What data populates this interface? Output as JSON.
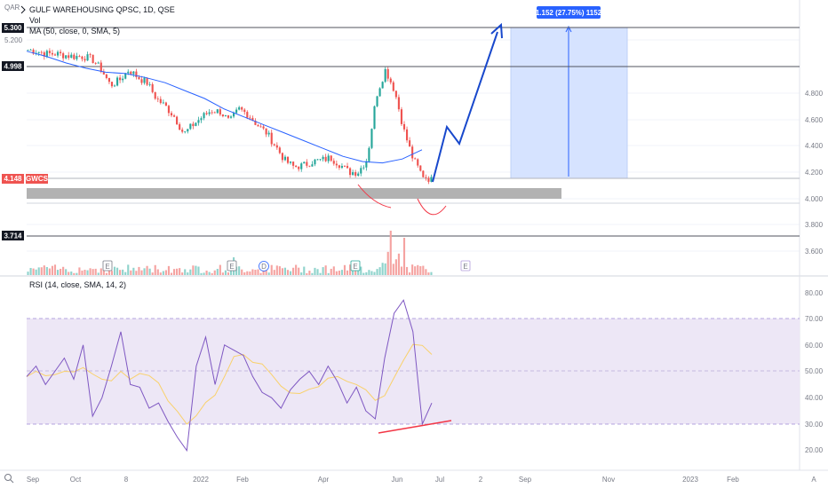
{
  "header": {
    "currency": "QAR",
    "title": "GULF WAREHOUSING QPSC, 1D, QSE",
    "vol_label": "Vol",
    "ma_label": "MA (50, close, 0, SMA, 5)",
    "rsi_label": "RSI (14, close, SMA, 14, 2)"
  },
  "price_tags": {
    "p5300": "5.300",
    "p4998": "4.998",
    "p4148": "4.148",
    "symbol_tag": "GWCS",
    "p3714": "3.714"
  },
  "measure_label": "1.152 (27.75%) 1152",
  "event_markers": [
    "E",
    "E",
    "D",
    "E",
    "E"
  ],
  "scale_mode": "A",
  "zoom_icon": "magnifier-icon",
  "colors": {
    "up": "#26a69a",
    "down": "#ef5350",
    "ma": "#2962ff",
    "rsi": "#7e57c2",
    "rsi_ma": "#f9d16b",
    "measure_fill": "#d6e3ff",
    "support_zone": "#b2b2b2",
    "projection": "#1848cc",
    "rsi_band": "#ede7f6"
  },
  "chart_data": {
    "type": "candlestick",
    "price_axis": {
      "ticks": [
        "5.300",
        "5.200",
        "4.800",
        "4.600",
        "4.400",
        "4.200",
        "4.000",
        "3.800",
        "3.600"
      ],
      "ylim": [
        3.55,
        5.37
      ]
    },
    "rsi_axis": {
      "ticks": [
        "80.00",
        "70.00",
        "60.00",
        "50.00",
        "40.00",
        "30.00",
        "20.00"
      ],
      "ylim": [
        16,
        83
      ],
      "band": [
        30,
        70
      ]
    },
    "time_axis": [
      "Sep",
      "Oct",
      "8",
      "2022",
      "Feb",
      "Apr",
      "Jun",
      "Jul",
      "2",
      "Sep",
      "Nov",
      "2023",
      "Feb"
    ],
    "series": [
      {
        "name": "GWCS",
        "approx_close": [
          5.13,
          5.12,
          5.1,
          5.1,
          5.09,
          5.08,
          5.08,
          5.06,
          4.98,
          4.86,
          4.9,
          4.98,
          4.92,
          4.88,
          4.76,
          4.7,
          4.62,
          4.49,
          4.56,
          4.62,
          4.67,
          4.66,
          4.58,
          4.68,
          4.64,
          4.56,
          4.5,
          4.4,
          4.29,
          4.24,
          4.25,
          4.28,
          4.29,
          4.31,
          4.26,
          4.2,
          4.2,
          4.3,
          4.78,
          4.98,
          4.82,
          4.52,
          4.3,
          4.18,
          4.14
        ]
      },
      {
        "name": "MA (50, close, 0, SMA, 5)",
        "approx_values": [
          5.12,
          5.08,
          5.03,
          4.99,
          4.96,
          4.95,
          4.92,
          4.88,
          4.82,
          4.76,
          4.68,
          4.62,
          4.56,
          4.5,
          4.44,
          4.38,
          4.32,
          4.28,
          4.27,
          4.3,
          4.37
        ]
      },
      {
        "name": "RSI (14, close, SMA, 14, 2)",
        "approx_values": [
          48,
          52,
          45,
          50,
          55,
          47,
          60,
          33,
          40,
          52,
          65,
          45,
          44,
          36,
          38,
          31,
          25,
          20,
          52,
          63,
          45,
          60,
          58,
          56,
          48,
          42,
          40,
          36,
          43,
          47,
          50,
          45,
          52,
          46,
          38,
          44,
          35,
          32,
          55,
          72,
          77,
          65,
          30,
          38
        ]
      }
    ],
    "annotations": {
      "support_zone": [
        4.02,
        4.08
      ],
      "horizontal_levels": [
        5.3,
        4.998,
        4.148,
        3.714
      ],
      "measure": {
        "from": 4.148,
        "to": 5.3,
        "change": 1.152
      },
      "rsi_bullish_divergence": true
    }
  }
}
